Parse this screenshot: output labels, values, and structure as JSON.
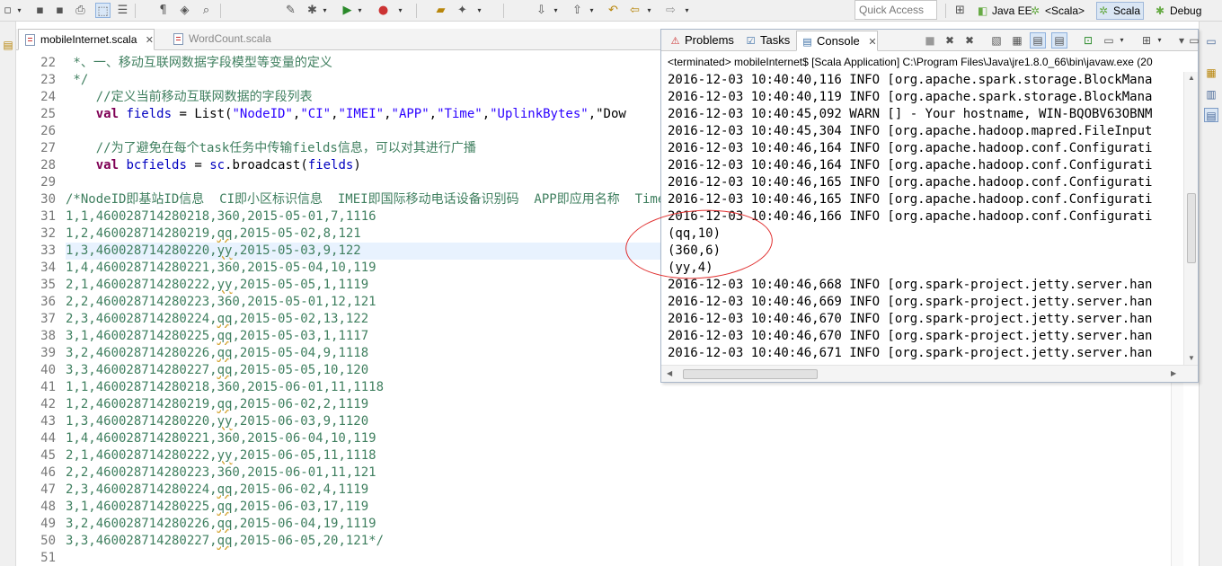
{
  "toolbar": {
    "quick_access_placeholder": "Quick Access",
    "perspectives": [
      "Java EE",
      "<Scala>",
      "Scala",
      "Debug"
    ]
  },
  "editor": {
    "tabs": [
      {
        "label": "mobileInternet.scala",
        "active": true
      },
      {
        "label": "WordCount.scala",
        "active": false
      }
    ],
    "highlighted_line": 33,
    "lines": [
      {
        "n": "22",
        "text": " *、一、移动互联网数据字段模型等变量的定义"
      },
      {
        "n": "23",
        "text": " */"
      },
      {
        "n": "24",
        "text": "    //定义当前移动互联网数据的字段列表"
      },
      {
        "n": "25",
        "text": "    val fields = List(\"NodeID\",\"CI\",\"IMEI\",\"APP\",\"Time\",\"UplinkBytes\",\"Dow"
      },
      {
        "n": "26",
        "text": ""
      },
      {
        "n": "27",
        "text": "    //为了避免在每个task任务中传输fields信息，可以对其进行广播"
      },
      {
        "n": "28",
        "text": "    val bcfields = sc.broadcast(fields)"
      },
      {
        "n": "29",
        "text": ""
      },
      {
        "n": "30",
        "text": "/*NodeID即基站ID信息  CI即小区标识信息  IMEI即国际移动电话设备识别码  APP即应用名称  Time即访问时间"
      },
      {
        "n": "31",
        "text": "1,1,460028714280218,360,2015-05-01,7,1116"
      },
      {
        "n": "32",
        "text": "1,2,460028714280219,qq,2015-05-02,8,121"
      },
      {
        "n": "33",
        "text": "1,3,460028714280220,yy,2015-05-03,9,122"
      },
      {
        "n": "34",
        "text": "1,4,460028714280221,360,2015-05-04,10,119"
      },
      {
        "n": "35",
        "text": "2,1,460028714280222,yy,2015-05-05,1,1119"
      },
      {
        "n": "36",
        "text": "2,2,460028714280223,360,2015-05-01,12,121"
      },
      {
        "n": "37",
        "text": "2,3,460028714280224,qq,2015-05-02,13,122"
      },
      {
        "n": "38",
        "text": "3,1,460028714280225,qq,2015-05-03,1,1117"
      },
      {
        "n": "39",
        "text": "3,2,460028714280226,qq,2015-05-04,9,1118"
      },
      {
        "n": "40",
        "text": "3,3,460028714280227,qq,2015-05-05,10,120"
      },
      {
        "n": "41",
        "text": "1,1,460028714280218,360,2015-06-01,11,1118"
      },
      {
        "n": "42",
        "text": "1,2,460028714280219,qq,2015-06-02,2,1119"
      },
      {
        "n": "43",
        "text": "1,3,460028714280220,yy,2015-06-03,9,1120"
      },
      {
        "n": "44",
        "text": "1,4,460028714280221,360,2015-06-04,10,119"
      },
      {
        "n": "45",
        "text": "2,1,460028714280222,yy,2015-06-05,11,1118"
      },
      {
        "n": "46",
        "text": "2,2,460028714280223,360,2015-06-01,11,121"
      },
      {
        "n": "47",
        "text": "2,3,460028714280224,qq,2015-06-02,4,1119"
      },
      {
        "n": "48",
        "text": "3,1,460028714280225,qq,2015-06-03,17,119"
      },
      {
        "n": "49",
        "text": "3,2,460028714280226,qq,2015-06-04,19,1119"
      },
      {
        "n": "50",
        "text": "3,3,460028714280227,qq,2015-06-05,20,121*/"
      },
      {
        "n": "51",
        "text": ""
      }
    ]
  },
  "console": {
    "tabs": [
      {
        "label": "Problems",
        "icon": "problems-icon",
        "active": false
      },
      {
        "label": "Tasks",
        "icon": "tasks-icon",
        "active": false
      },
      {
        "label": "Console",
        "icon": "console-icon",
        "active": true
      }
    ],
    "status": "<terminated> mobileInternet$ [Scala Application] C:\\Program Files\\Java\\jre1.8.0_66\\bin\\javaw.exe (20",
    "lines": [
      "2016-12-03 10:40:40,116 INFO [org.apache.spark.storage.BlockMana",
      "2016-12-03 10:40:40,119 INFO [org.apache.spark.storage.BlockMana",
      "2016-12-03 10:40:45,092 WARN [] - Your hostname, WIN-BQOBV63OBNM",
      "2016-12-03 10:40:45,304 INFO [org.apache.hadoop.mapred.FileInput",
      "2016-12-03 10:40:46,164 INFO [org.apache.hadoop.conf.Configurati",
      "2016-12-03 10:40:46,164 INFO [org.apache.hadoop.conf.Configurati",
      "2016-12-03 10:40:46,165 INFO [org.apache.hadoop.conf.Configurati",
      "2016-12-03 10:40:46,165 INFO [org.apache.hadoop.conf.Configurati",
      "2016-12-03 10:40:46,166 INFO [org.apache.hadoop.conf.Configurati",
      "(qq,10)",
      "(360,6)",
      "(yy,4)",
      "2016-12-03 10:40:46,668 INFO [org.spark-project.jetty.server.han",
      "2016-12-03 10:40:46,669 INFO [org.spark-project.jetty.server.han",
      "2016-12-03 10:40:46,670 INFO [org.spark-project.jetty.server.han",
      "2016-12-03 10:40:46,670 INFO [org.spark-project.jetty.server.han",
      "2016-12-03 10:40:46,671 INFO [org.spark-project.jetty.server.han"
    ]
  },
  "colors": {
    "keyword": "#7f0055",
    "variable": "#0000c0",
    "string": "#2a00ff",
    "comment": "#3f7f5f",
    "line_highlight": "#e8f2fe",
    "annotation": "#e03030"
  }
}
